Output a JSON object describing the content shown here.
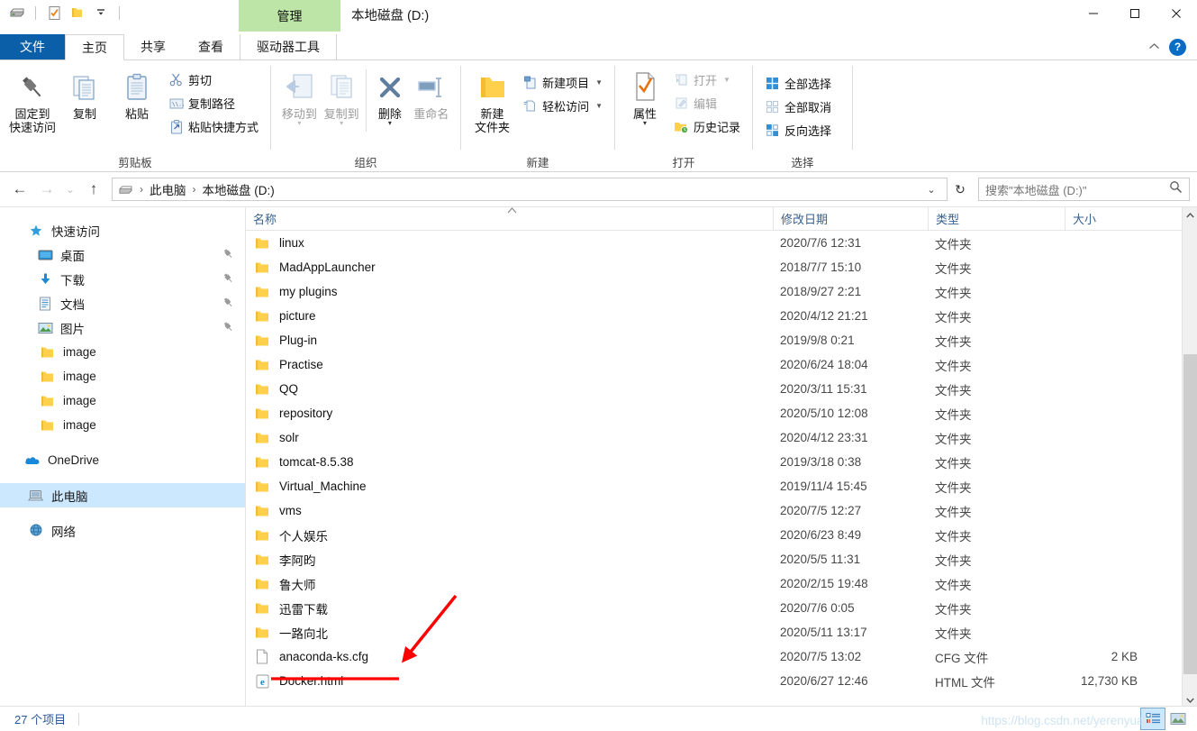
{
  "window": {
    "title": "本地磁盘 (D:)",
    "contextual_tab": "管理",
    "minimize": "—",
    "maximize": "▢",
    "close": "✕",
    "collapse_ribbon": "︿",
    "help": "?"
  },
  "quick_access_toolbar": {
    "items": [
      {
        "name": "drive-icon",
        "label": ""
      },
      {
        "name": "properties-icon",
        "label": ""
      },
      {
        "name": "new-folder-icon",
        "label": ""
      },
      {
        "name": "customize-dropdown-icon",
        "label": "▾"
      }
    ]
  },
  "tabs": [
    {
      "id": "file",
      "label": "文件"
    },
    {
      "id": "home",
      "label": "主页"
    },
    {
      "id": "share",
      "label": "共享"
    },
    {
      "id": "view",
      "label": "查看"
    },
    {
      "id": "drive-tools",
      "label": "驱动器工具"
    }
  ],
  "ribbon": {
    "groups": [
      {
        "label": "剪贴板",
        "big_buttons": [
          {
            "label_line1": "固定到",
            "label_line2": "快速访问",
            "icon": "pin-icon"
          },
          {
            "label_line1": "复制",
            "label_line2": "",
            "icon": "copy-icon"
          },
          {
            "label_line1": "粘贴",
            "label_line2": "",
            "icon": "paste-icon"
          }
        ],
        "small_buttons": [
          {
            "label": "剪切",
            "icon": "scissors-icon"
          },
          {
            "label": "复制路径",
            "icon": "copy-path-icon"
          },
          {
            "label": "粘贴快捷方式",
            "icon": "paste-shortcut-icon"
          }
        ]
      },
      {
        "label": "组织",
        "big_buttons": [
          {
            "label_line1": "移动到",
            "label_line2": "",
            "icon": "move-to-icon",
            "dimmed": true,
            "has_caret": true
          },
          {
            "label_line1": "复制到",
            "label_line2": "",
            "icon": "copy-to-icon",
            "dimmed": true,
            "has_caret": true
          },
          {
            "label_line1": "删除",
            "label_line2": "",
            "icon": "delete-icon",
            "has_caret": true
          },
          {
            "label_line1": "重命名",
            "label_line2": "",
            "icon": "rename-icon",
            "dimmed": true
          }
        ],
        "small_buttons": []
      },
      {
        "label": "新建",
        "big_buttons": [
          {
            "label_line1": "新建",
            "label_line2": "文件夹",
            "icon": "new-folder-icon"
          }
        ],
        "small_buttons": [
          {
            "label": "新建项目",
            "icon": "new-item-icon",
            "has_caret": true
          },
          {
            "label": "轻松访问",
            "icon": "easy-access-icon",
            "has_caret": true
          }
        ]
      },
      {
        "label": "打开",
        "big_buttons": [
          {
            "label_line1": "属性",
            "label_line2": "",
            "icon": "properties-icon",
            "has_caret": true
          }
        ],
        "small_buttons": [
          {
            "label": "打开",
            "icon": "open-icon",
            "dimmed": true,
            "has_caret": true
          },
          {
            "label": "编辑",
            "icon": "edit-icon",
            "dimmed": true
          },
          {
            "label": "历史记录",
            "icon": "history-icon"
          }
        ]
      },
      {
        "label": "选择",
        "big_buttons": [],
        "small_buttons": [
          {
            "label": "全部选择",
            "icon": "select-all-icon"
          },
          {
            "label": "全部取消",
            "icon": "select-none-icon"
          },
          {
            "label": "反向选择",
            "icon": "invert-selection-icon"
          }
        ]
      }
    ]
  },
  "addressbar": {
    "back": "←",
    "forward": "→",
    "recent": "⌄",
    "up": "↑",
    "breadcrumbs": [
      "此电脑",
      "本地磁盘 (D:)"
    ],
    "dropdown": "⌄",
    "refresh": "↻",
    "search_placeholder": "搜索\"本地磁盘 (D:)\"",
    "search_value": ""
  },
  "sidebar": {
    "items": [
      {
        "label": "快速访问",
        "icon": "star-icon",
        "level": 0,
        "pinned": false,
        "selected": false
      },
      {
        "label": "桌面",
        "icon": "desktop-icon",
        "level": 1,
        "pinned": true,
        "selected": false
      },
      {
        "label": "下载",
        "icon": "downloads-icon",
        "level": 1,
        "pinned": true,
        "selected": false
      },
      {
        "label": "文档",
        "icon": "documents-icon",
        "level": 1,
        "pinned": true,
        "selected": false
      },
      {
        "label": "图片",
        "icon": "pictures-icon",
        "level": 1,
        "pinned": true,
        "selected": false
      },
      {
        "label": "image",
        "icon": "folder-icon",
        "level": 1,
        "pinned": false,
        "selected": false
      },
      {
        "label": "image",
        "icon": "folder-icon",
        "level": 1,
        "pinned": false,
        "selected": false
      },
      {
        "label": "image",
        "icon": "folder-icon",
        "level": 1,
        "pinned": false,
        "selected": false
      },
      {
        "label": "image",
        "icon": "folder-icon",
        "level": 1,
        "pinned": false,
        "selected": false
      },
      {
        "label": "OneDrive",
        "icon": "onedrive-icon",
        "level": 0,
        "pinned": false,
        "selected": false
      },
      {
        "label": "此电脑",
        "icon": "this-pc-icon",
        "level": 0,
        "pinned": false,
        "selected": true
      },
      {
        "label": "网络",
        "icon": "network-icon",
        "level": 0,
        "pinned": false,
        "selected": false
      }
    ]
  },
  "filelist": {
    "columns": [
      "名称",
      "修改日期",
      "类型",
      "大小"
    ],
    "sort_column": "名称",
    "sort_direction": "asc",
    "rows": [
      {
        "name": "linux",
        "date": "2020/7/6 12:31",
        "type": "文件夹",
        "size": "",
        "icon": "folder-icon"
      },
      {
        "name": "MadAppLauncher",
        "date": "2018/7/7 15:10",
        "type": "文件夹",
        "size": "",
        "icon": "folder-icon"
      },
      {
        "name": "my plugins",
        "date": "2018/9/27 2:21",
        "type": "文件夹",
        "size": "",
        "icon": "folder-icon"
      },
      {
        "name": "picture",
        "date": "2020/4/12 21:21",
        "type": "文件夹",
        "size": "",
        "icon": "folder-icon"
      },
      {
        "name": "Plug-in",
        "date": "2019/9/8 0:21",
        "type": "文件夹",
        "size": "",
        "icon": "folder-icon"
      },
      {
        "name": "Practise",
        "date": "2020/6/24 18:04",
        "type": "文件夹",
        "size": "",
        "icon": "folder-icon"
      },
      {
        "name": "QQ",
        "date": "2020/3/11 15:31",
        "type": "文件夹",
        "size": "",
        "icon": "folder-icon"
      },
      {
        "name": "repository",
        "date": "2020/5/10 12:08",
        "type": "文件夹",
        "size": "",
        "icon": "folder-icon"
      },
      {
        "name": "solr",
        "date": "2020/4/12 23:31",
        "type": "文件夹",
        "size": "",
        "icon": "folder-icon"
      },
      {
        "name": "tomcat-8.5.38",
        "date": "2019/3/18 0:38",
        "type": "文件夹",
        "size": "",
        "icon": "folder-icon"
      },
      {
        "name": "Virtual_Machine",
        "date": "2019/11/4 15:45",
        "type": "文件夹",
        "size": "",
        "icon": "folder-icon"
      },
      {
        "name": "vms",
        "date": "2020/7/5 12:27",
        "type": "文件夹",
        "size": "",
        "icon": "folder-icon"
      },
      {
        "name": "个人娱乐",
        "date": "2020/6/23 8:49",
        "type": "文件夹",
        "size": "",
        "icon": "folder-icon"
      },
      {
        "name": "李阿昀",
        "date": "2020/5/5 11:31",
        "type": "文件夹",
        "size": "",
        "icon": "folder-icon"
      },
      {
        "name": "鲁大师",
        "date": "2020/2/15 19:48",
        "type": "文件夹",
        "size": "",
        "icon": "folder-icon"
      },
      {
        "name": "迅雷下载",
        "date": "2020/7/6 0:05",
        "type": "文件夹",
        "size": "",
        "icon": "folder-icon"
      },
      {
        "name": "一路向北",
        "date": "2020/5/11 13:17",
        "type": "文件夹",
        "size": "",
        "icon": "folder-icon"
      },
      {
        "name": "anaconda-ks.cfg",
        "date": "2020/7/5 13:02",
        "type": "CFG 文件",
        "size": "2 KB",
        "icon": "generic-file-icon"
      },
      {
        "name": "Docker.html",
        "date": "2020/6/27 12:46",
        "type": "HTML 文件",
        "size": "12,730 KB",
        "icon": "html-file-icon"
      }
    ]
  },
  "statusbar": {
    "item_count": "27 个项目",
    "view_details": "details-view-icon",
    "view_large_icons": "large-icons-view-icon"
  },
  "watermark": "https://blog.csdn.net/yerenyuan",
  "colors": {
    "accent_blue": "#0a5fa8",
    "contextual_green": "#bde5a8",
    "selection_blue": "#cce8ff",
    "folder_yellow": "#ffd04b",
    "annotation_red": "#fe0000",
    "header_text": "#38618f"
  }
}
